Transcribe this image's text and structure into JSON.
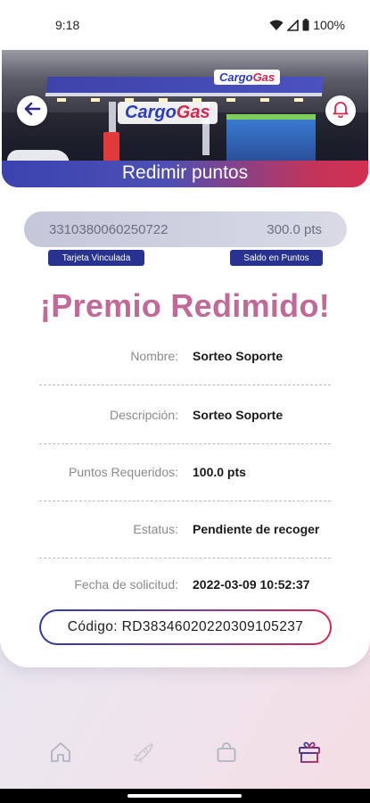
{
  "status_bar": {
    "time": "9:18",
    "battery": "100%",
    "icons": [
      "wifi-icon",
      "signal-icon",
      "battery-icon"
    ]
  },
  "banner": {
    "brand_main_left": "Cargo",
    "brand_main_right": "Gas",
    "brand_small_left": "Cargo",
    "brand_small_right": "Gas",
    "title": "Redimir puntos",
    "back_icon": "arrow-left-icon",
    "bell_icon": "bell-icon"
  },
  "account": {
    "card_number": "3310380060250722",
    "balance": "300.0 pts",
    "card_tag": "Tarjeta Vinculada",
    "balance_tag": "Saldo en Puntos"
  },
  "headline": "¡Premio Redimido!",
  "details": [
    {
      "label": "Nombre:",
      "value": "Sorteo Soporte"
    },
    {
      "label": "Descripción:",
      "value": "Sorteo Soporte"
    },
    {
      "label": "Puntos Requeridos:",
      "value": "100.0 pts"
    },
    {
      "label": "Estatus:",
      "value": "Pendiente de recoger"
    },
    {
      "label": "Fecha de solicitud:",
      "value": "2022-03-09 10:52:37"
    }
  ],
  "code": "Código: RD38346020220309105237",
  "nav": {
    "items": [
      "home-icon",
      "rocket-icon",
      "bag-icon",
      "gift-icon"
    ],
    "active": "gift-icon"
  },
  "colors": {
    "accent_blue": "#27338f",
    "accent_red": "#d5284f",
    "headline": "#c26a97"
  }
}
